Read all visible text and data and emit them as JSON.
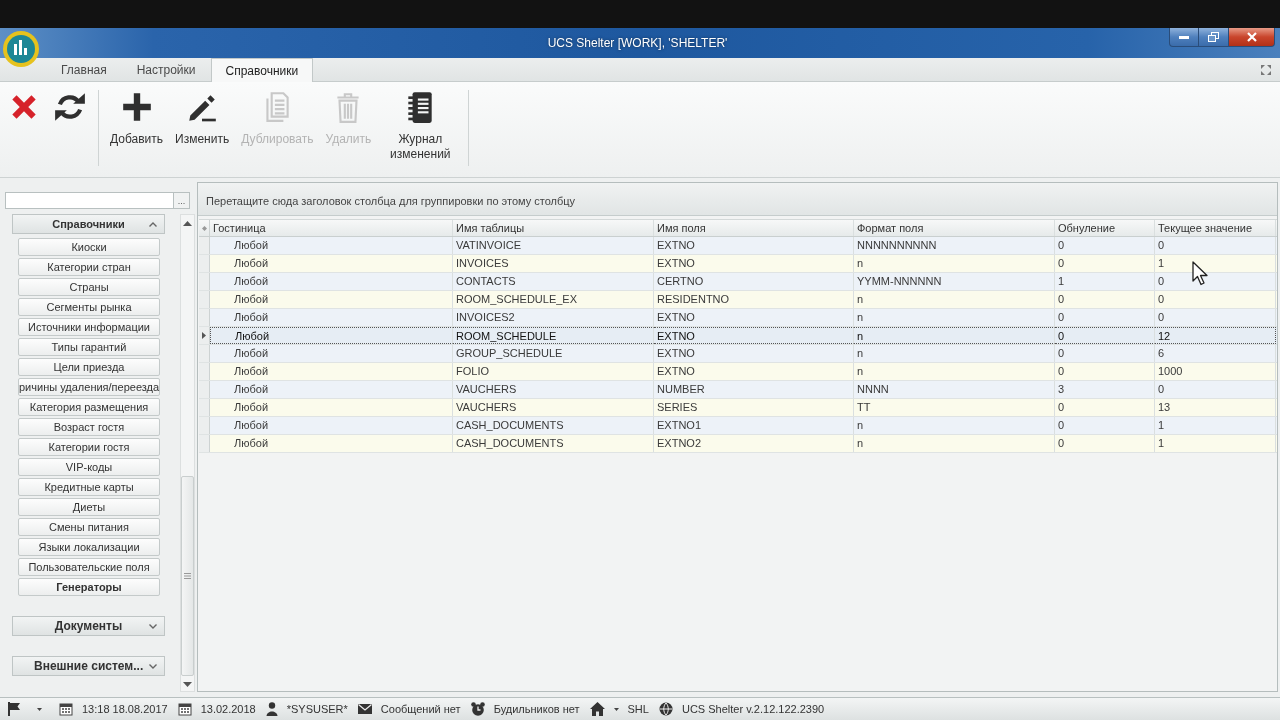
{
  "window": {
    "title": "UCS Shelter [WORK], 'SHELTER'"
  },
  "tabs": [
    {
      "label": "Главная",
      "selected": false
    },
    {
      "label": "Настройки",
      "selected": false
    },
    {
      "label": "Справочники",
      "selected": true
    }
  ],
  "ribbon": {
    "groups": [
      {
        "buttons": [
          {
            "kind": "cancel",
            "disabled": false
          },
          {
            "kind": "refresh",
            "disabled": false
          }
        ]
      },
      {
        "buttons": [
          {
            "kind": "add",
            "label": "Добавить",
            "disabled": false
          },
          {
            "kind": "edit",
            "label": "Изменить",
            "disabled": false
          },
          {
            "kind": "duplicate",
            "label": "Дублировать",
            "disabled": true
          },
          {
            "kind": "delete",
            "label": "Удалить",
            "disabled": true
          },
          {
            "kind": "journal",
            "label": "Журнал изменений",
            "disabled": false
          }
        ]
      }
    ]
  },
  "sidebar": {
    "search": {
      "button": "..."
    },
    "groups": [
      {
        "title": "Справочники",
        "expanded": true,
        "items": [
          {
            "label": "Киоски",
            "selected": false
          },
          {
            "label": "Категории стран",
            "selected": false
          },
          {
            "label": "Страны",
            "selected": false
          },
          {
            "label": "Сегменты рынка",
            "selected": false
          },
          {
            "label": "Источники информации",
            "selected": false
          },
          {
            "label": "Типы гарантий",
            "selected": false
          },
          {
            "label": "Цели приезда",
            "selected": false
          },
          {
            "label": "ричины удаления/переезда",
            "selected": false
          },
          {
            "label": "Категория размещения",
            "selected": false
          },
          {
            "label": "Возраст гостя",
            "selected": false
          },
          {
            "label": "Категории гостя",
            "selected": false
          },
          {
            "label": "VIP-коды",
            "selected": false
          },
          {
            "label": "Кредитные карты",
            "selected": false
          },
          {
            "label": "Диеты",
            "selected": false
          },
          {
            "label": "Смены питания",
            "selected": false
          },
          {
            "label": "Языки локализации",
            "selected": false
          },
          {
            "label": "Пользовательские поля",
            "selected": false
          },
          {
            "label": "Генераторы",
            "selected": true
          }
        ]
      },
      {
        "title": "Документы",
        "expanded": false
      },
      {
        "title": "Внешние систем...",
        "expanded": false
      }
    ]
  },
  "grid": {
    "group_panel_hint": "Перетащите сюда заголовок столбца для группировки по этому столбцу",
    "columns": [
      "Гостиница",
      "Имя таблицы",
      "Имя поля",
      "Формат поля",
      "Обнуление",
      "Текущее значение"
    ],
    "rows": [
      {
        "cells": [
          "Любой",
          "VATINVOICE",
          "EXTNO",
          "NNNNNNNNNN",
          "0",
          "0"
        ],
        "selected": false
      },
      {
        "cells": [
          "Любой",
          "INVOICES",
          "EXTNO",
          "n",
          "0",
          "1"
        ],
        "selected": false
      },
      {
        "cells": [
          "Любой",
          "CONTACTS",
          "CERTNO",
          "YYMM-NNNNNN",
          "1",
          "0"
        ],
        "selected": false
      },
      {
        "cells": [
          "Любой",
          "ROOM_SCHEDULE_EX",
          "RESIDENTNO",
          "n",
          "0",
          "0"
        ],
        "selected": false
      },
      {
        "cells": [
          "Любой",
          "INVOICES2",
          "EXTNO",
          "n",
          "0",
          "0"
        ],
        "selected": false
      },
      {
        "cells": [
          "Любой",
          "ROOM_SCHEDULE",
          "EXTNO",
          "n",
          "0",
          "12"
        ],
        "selected": true
      },
      {
        "cells": [
          "Любой",
          "GROUP_SCHEDULE",
          "EXTNO",
          "n",
          "0",
          "6"
        ],
        "selected": false
      },
      {
        "cells": [
          "Любой",
          "FOLIO",
          "EXTNO",
          "n",
          "0",
          "1000"
        ],
        "selected": false
      },
      {
        "cells": [
          "Любой",
          "VAUCHERS",
          "NUMBER",
          "NNNN",
          "3",
          "0"
        ],
        "selected": false
      },
      {
        "cells": [
          "Любой",
          "VAUCHERS",
          "SERIES",
          "TT",
          "0",
          "13"
        ],
        "selected": false
      },
      {
        "cells": [
          "Любой",
          "CASH_DOCUMENTS",
          "EXTNO1",
          "n",
          "0",
          "1"
        ],
        "selected": false
      },
      {
        "cells": [
          "Любой",
          "CASH_DOCUMENTS",
          "EXTNO2",
          "n",
          "0",
          "1"
        ],
        "selected": false
      }
    ]
  },
  "status_bar": [
    {
      "kind": "flag",
      "dropdown": true
    },
    {
      "kind": "calendar",
      "text": "13:18 18.08.2017",
      "dropdown": false
    },
    {
      "kind": "calendar",
      "text": "13.02.2018",
      "dropdown": false
    },
    {
      "kind": "user",
      "text": "*SYSUSER*",
      "dropdown": false
    },
    {
      "kind": "messages",
      "text": "Сообщений нет",
      "dropdown": false
    },
    {
      "kind": "alarms",
      "text": "Будильников нет",
      "dropdown": false
    },
    {
      "kind": "home",
      "text": "SHL",
      "dropdown": true
    },
    {
      "kind": "version",
      "text": "UCS Shelter v.2.12.122.2390",
      "dropdown": false
    }
  ]
}
